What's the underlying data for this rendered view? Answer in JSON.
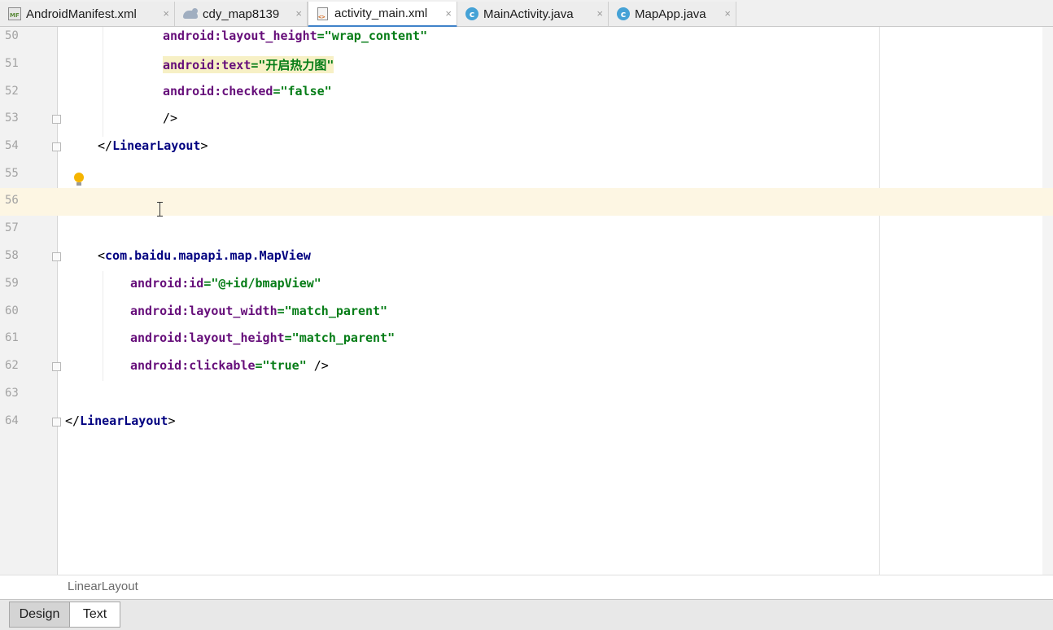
{
  "tabs": [
    {
      "label": "AndroidManifest.xml",
      "icon": "manifest-file-icon",
      "active": false
    },
    {
      "label": "cdy_map8139",
      "icon": "gradle-elephant-icon",
      "active": false
    },
    {
      "label": "activity_main.xml",
      "icon": "xml-file-icon",
      "active": true
    },
    {
      "label": "MainActivity.java",
      "icon": "java-class-icon",
      "active": false
    },
    {
      "label": "MapApp.java",
      "icon": "java-class-icon",
      "active": false
    }
  ],
  "close_glyph": "×",
  "lines": [
    {
      "num": "50",
      "tokens": [
        "android:",
        "layout_height",
        "=\"wrap_content\""
      ]
    },
    {
      "num": "51",
      "tokens": [
        "android:",
        "text",
        "=\"开启热力图\""
      ]
    },
    {
      "num": "52",
      "tokens": [
        "android:",
        "checked",
        "=\"false\""
      ]
    },
    {
      "num": "53",
      "tokens": [
        "/>"
      ]
    },
    {
      "num": "54",
      "tokens": [
        "</",
        "LinearLayout",
        ">"
      ]
    },
    {
      "num": "55",
      "tokens": []
    },
    {
      "num": "56",
      "tokens": []
    },
    {
      "num": "57",
      "tokens": []
    },
    {
      "num": "58",
      "tokens": [
        "<",
        "com.baidu.mapapi.map.MapView"
      ]
    },
    {
      "num": "59",
      "tokens": [
        "android:",
        "id",
        "=\"@+id/bmapView\""
      ]
    },
    {
      "num": "60",
      "tokens": [
        "android:",
        "layout_width",
        "=\"match_parent\""
      ]
    },
    {
      "num": "61",
      "tokens": [
        "android:",
        "layout_height",
        "=\"match_parent\""
      ]
    },
    {
      "num": "62",
      "tokens": [
        "android:",
        "clickable",
        "=\"true\"",
        " />"
      ]
    },
    {
      "num": "63",
      "tokens": []
    },
    {
      "num": "64",
      "tokens": [
        "</",
        "LinearLayout",
        ">"
      ]
    }
  ],
  "breadcrumb": "LinearLayout",
  "bottom_tabs": {
    "design": "Design",
    "text": "Text"
  },
  "colors": {
    "accent": "#4083c9",
    "namespace": "#660e7a",
    "value": "#067d17",
    "tag": "#000080",
    "current_line": "#fdf6e3"
  }
}
